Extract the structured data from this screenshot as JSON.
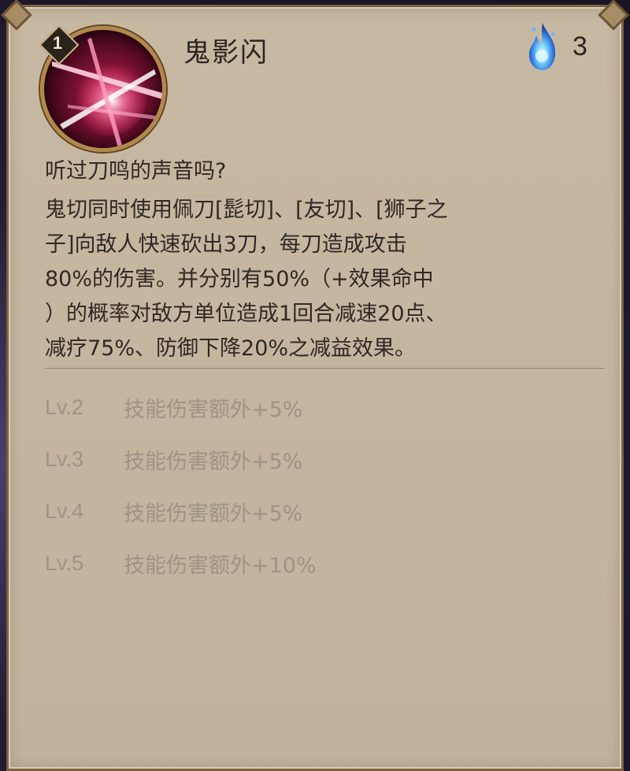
{
  "skill": {
    "cost": "1",
    "name": "鬼影闪",
    "fire_count": "3",
    "icon": "blade-slash-icon",
    "fire_icon": "blue-soul-fire-icon"
  },
  "flavor_text": "听过刀鸣的声音吗?",
  "description_lines": [
    "鬼切同时使用佩刀[髭切]、[友切]、[狮子之",
    "子]向敌人快速砍出3刀，每刀造成攻击",
    "80%的伤害。并分别有50%（+效果命中",
    "）的概率对敌方单位造成1回合减速20点、",
    "减疗75%、防御下降20%之减益效果。"
  ],
  "levels": [
    {
      "level": "Lv.2",
      "effect": "技能伤害额外+5%"
    },
    {
      "level": "Lv.3",
      "effect": "技能伤害额外+5%"
    },
    {
      "level": "Lv.4",
      "effect": "技能伤害额外+5%"
    },
    {
      "level": "Lv.5",
      "effect": "技能伤害额外+10%"
    }
  ],
  "colors": {
    "panel_bg": "#c4b59f",
    "frame": "#7a6240",
    "text_primary": "#2f2924",
    "text_muted": "#9e9384",
    "fire": "#3fa9ff"
  }
}
